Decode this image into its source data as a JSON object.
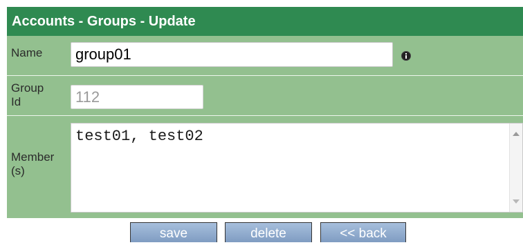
{
  "window": {
    "title": "Accounts - Groups - Update"
  },
  "form": {
    "name": {
      "label": "Name",
      "value": "group01"
    },
    "group_id": {
      "label_line1": "Group",
      "label_line2": "Id",
      "value": "112"
    },
    "members": {
      "label_line1": "Member",
      "label_line2": "(s)",
      "value": "test01, test02"
    }
  },
  "buttons": {
    "save": "save",
    "delete": "delete",
    "back": "<< back"
  },
  "icons": {
    "info": "info-icon",
    "scroll_up": "scroll-up-arrow-icon",
    "scroll_down": "scroll-down-arrow-icon"
  }
}
